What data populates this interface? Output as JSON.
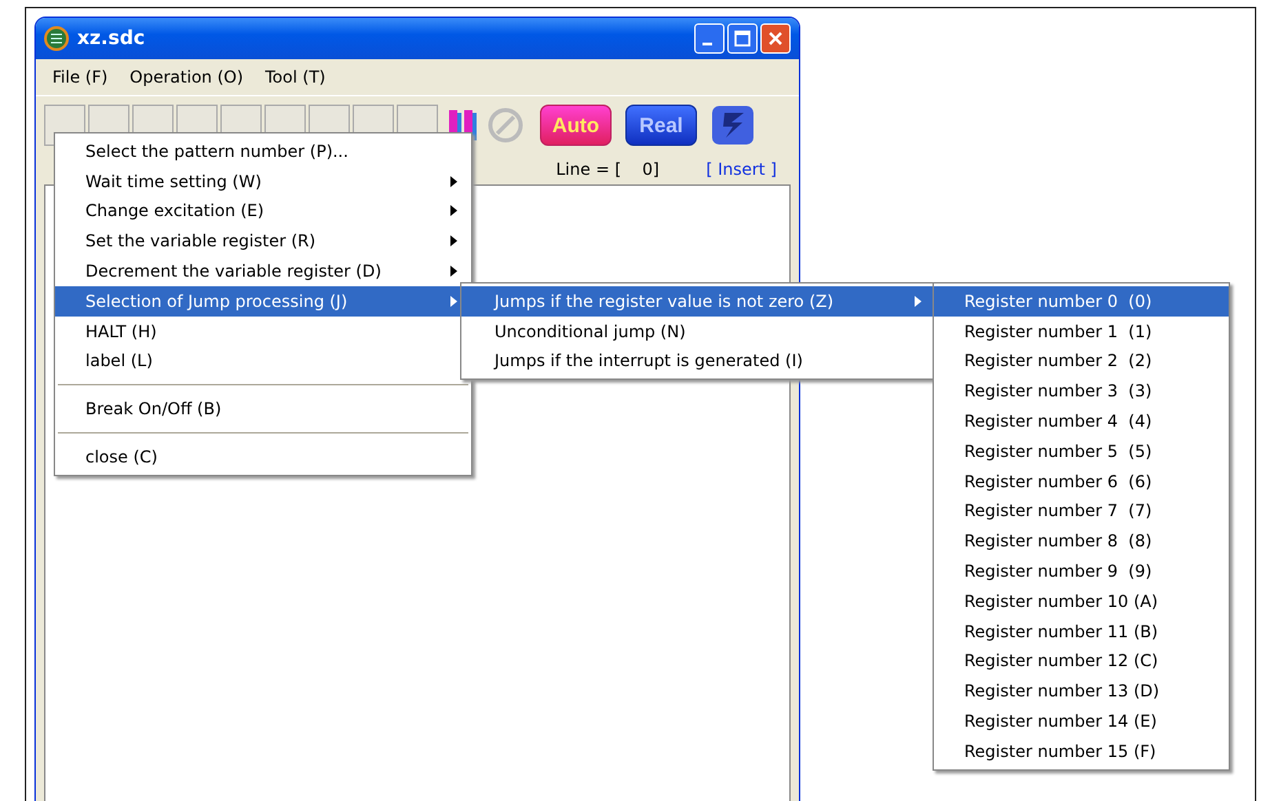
{
  "window": {
    "title": "xz.sdc"
  },
  "menubar": [
    {
      "label": "File (F)"
    },
    {
      "label": "Operation (O)"
    },
    {
      "label": "Tool (T)"
    }
  ],
  "toolbar": {
    "auto_label": "Auto",
    "real_label": "Real"
  },
  "status": {
    "line": "Line = [    0]",
    "mode": "[ Insert ]"
  },
  "operation_menu": [
    {
      "kind": "item",
      "label": "Select the pattern number (P)...",
      "submenu": false,
      "selected": false
    },
    {
      "kind": "item",
      "label": "Wait time setting (W)",
      "submenu": true,
      "selected": false
    },
    {
      "kind": "item",
      "label": "Change excitation (E)",
      "submenu": true,
      "selected": false
    },
    {
      "kind": "item",
      "label": "Set the variable register (R)",
      "submenu": true,
      "selected": false
    },
    {
      "kind": "item",
      "label": "Decrement the variable register (D)",
      "submenu": true,
      "selected": false
    },
    {
      "kind": "item",
      "label": "Selection of Jump processing (J)",
      "submenu": true,
      "selected": true
    },
    {
      "kind": "item",
      "label": "HALT (H)",
      "submenu": false,
      "selected": false
    },
    {
      "kind": "item",
      "label": "label (L)",
      "submenu": false,
      "selected": false
    },
    {
      "kind": "separator"
    },
    {
      "kind": "item",
      "label": "Break On/Off (B)",
      "submenu": false,
      "selected": false
    },
    {
      "kind": "separator"
    },
    {
      "kind": "item",
      "label": "close (C)",
      "submenu": false,
      "selected": false
    }
  ],
  "jump_menu": [
    {
      "kind": "item",
      "label": "Jumps if the register value is not zero (Z)",
      "submenu": true,
      "selected": true
    },
    {
      "kind": "item",
      "label": "Unconditional jump (N)",
      "submenu": false,
      "selected": false
    },
    {
      "kind": "item",
      "label": "Jumps if the interrupt is generated (I)",
      "submenu": false,
      "selected": false
    }
  ],
  "register_menu": [
    {
      "kind": "item",
      "label": "Register number 0  (0)",
      "submenu": false,
      "selected": true
    },
    {
      "kind": "item",
      "label": "Register number 1  (1)",
      "submenu": false,
      "selected": false
    },
    {
      "kind": "item",
      "label": "Register number 2  (2)",
      "submenu": false,
      "selected": false
    },
    {
      "kind": "item",
      "label": "Register number 3  (3)",
      "submenu": false,
      "selected": false
    },
    {
      "kind": "item",
      "label": "Register number 4  (4)",
      "submenu": false,
      "selected": false
    },
    {
      "kind": "item",
      "label": "Register number 5  (5)",
      "submenu": false,
      "selected": false
    },
    {
      "kind": "item",
      "label": "Register number 6  (6)",
      "submenu": false,
      "selected": false
    },
    {
      "kind": "item",
      "label": "Register number 7  (7)",
      "submenu": false,
      "selected": false
    },
    {
      "kind": "item",
      "label": "Register number 8  (8)",
      "submenu": false,
      "selected": false
    },
    {
      "kind": "item",
      "label": "Register number 9  (9)",
      "submenu": false,
      "selected": false
    },
    {
      "kind": "item",
      "label": "Register number 10 (A)",
      "submenu": false,
      "selected": false
    },
    {
      "kind": "item",
      "label": "Register number 11 (B)",
      "submenu": false,
      "selected": false
    },
    {
      "kind": "item",
      "label": "Register number 12 (C)",
      "submenu": false,
      "selected": false
    },
    {
      "kind": "item",
      "label": "Register number 13 (D)",
      "submenu": false,
      "selected": false
    },
    {
      "kind": "item",
      "label": "Register number 14 (E)",
      "submenu": false,
      "selected": false
    },
    {
      "kind": "item",
      "label": "Register number 15 (F)",
      "submenu": false,
      "selected": false
    }
  ]
}
